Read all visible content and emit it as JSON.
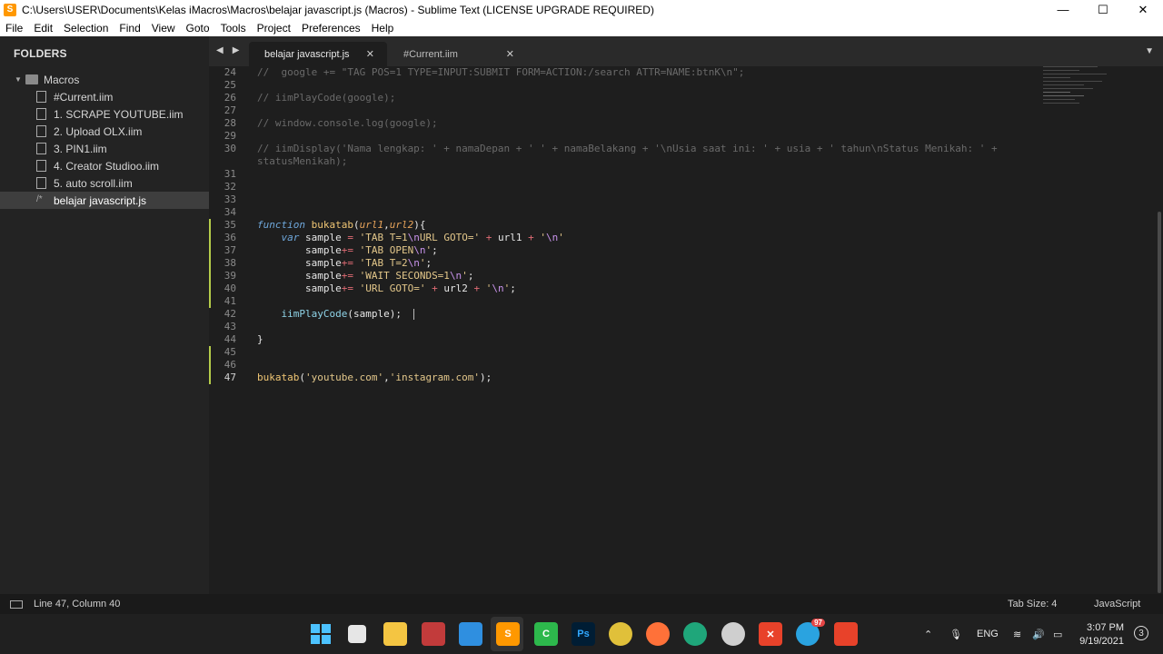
{
  "window": {
    "title": "C:\\Users\\USER\\Documents\\Kelas iMacros\\Macros\\belajar javascript.js (Macros) - Sublime Text (LICENSE UPGRADE REQUIRED)",
    "minimize": "—",
    "maximize": "☐",
    "close": "✕"
  },
  "menu": [
    "File",
    "Edit",
    "Selection",
    "Find",
    "View",
    "Goto",
    "Tools",
    "Project",
    "Preferences",
    "Help"
  ],
  "sidebar": {
    "heading": "FOLDERS",
    "root": "Macros",
    "files": [
      "#Current.iim",
      "1. SCRAPE YOUTUBE.iim",
      "2. Upload OLX.iim",
      "3. PIN1.iim",
      "4. Creator Studioo.iim",
      "5. auto scroll.iim",
      "belajar javascript.js"
    ],
    "active_index": 6
  },
  "tabs": [
    {
      "label": "belajar javascript.js",
      "active": true
    },
    {
      "label": "#Current.iim",
      "active": false
    }
  ],
  "editor": {
    "lines": [
      {
        "n": "24",
        "text": "//  google += \"TAG POS=1 TYPE=INPUT:SUBMIT FORM=ACTION:/search ATTR=NAME:btnK\\n\";"
      },
      {
        "n": "25",
        "text": ""
      },
      {
        "n": "26",
        "text": "// iimPlayCode(google);"
      },
      {
        "n": "27",
        "text": ""
      },
      {
        "n": "28",
        "text": "// window.console.log(google);"
      },
      {
        "n": "29",
        "text": ""
      },
      {
        "n": "30",
        "text": "// iimDisplay('Nama lengkap: ' + namaDepan + ' ' + namaBelakang + '\\nUsia saat ini: ' + usia + ' tahun\\nStatus Menikah: ' +"
      },
      {
        "n": "",
        "text": "statusMenikah);"
      },
      {
        "n": "31",
        "text": ""
      },
      {
        "n": "32",
        "text": ""
      },
      {
        "n": "33",
        "text": ""
      },
      {
        "n": "34",
        "text": ""
      },
      {
        "n": "35",
        "text": "function bukatab(url1,url2){"
      },
      {
        "n": "36",
        "text": "    var sample = 'TAB T=1\\nURL GOTO=' + url1 + '\\n'"
      },
      {
        "n": "37",
        "text": "        sample+= 'TAB OPEN\\n';"
      },
      {
        "n": "38",
        "text": "        sample+= 'TAB T=2\\n';"
      },
      {
        "n": "39",
        "text": "        sample+= 'WAIT SECONDS=1\\n';"
      },
      {
        "n": "40",
        "text": "        sample+= 'URL GOTO=' + url2 + '\\n';"
      },
      {
        "n": "41",
        "text": ""
      },
      {
        "n": "42",
        "text": "    iimPlayCode(sample);"
      },
      {
        "n": "43",
        "text": ""
      },
      {
        "n": "44",
        "text": "}"
      },
      {
        "n": "45",
        "text": ""
      },
      {
        "n": "46",
        "text": ""
      },
      {
        "n": "47",
        "text": "bukatab('youtube.com','instagram.com');"
      }
    ]
  },
  "status": {
    "position": "Line 47, Column 40",
    "tab_size": "Tab Size: 4",
    "syntax": "JavaScript"
  },
  "taskbar": {
    "apps": [
      "windows-start",
      "file-manager",
      "file-explorer",
      "draw-app",
      "notes-app",
      "sublime-text",
      "camtasia",
      "photoshop",
      "chrome",
      "firefox",
      "edge",
      "ball-app",
      "xampp",
      "telegram",
      "camtasia-recorder"
    ],
    "telegram_badge": "97",
    "language": "ENG",
    "time": "3:07 PM",
    "date": "9/19/2021",
    "notifications": "3",
    "colors": {
      "sublime": "#ff9800",
      "photoshop": "#001d34",
      "camtasia": "#2db84c",
      "xampp": "#e8422a"
    }
  }
}
